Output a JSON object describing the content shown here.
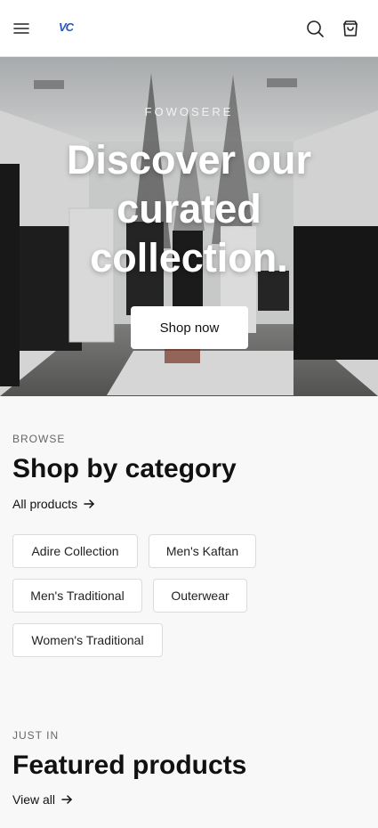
{
  "header": {
    "logo_text": "VC",
    "icons": [
      "hamburger-menu-icon",
      "search-icon",
      "shopping-bag-icon"
    ]
  },
  "hero": {
    "eyebrow": "FOWOSERE",
    "title": "Discover our curated collection.",
    "cta_label": "Shop now"
  },
  "categories": {
    "eyebrow": "BROWSE",
    "title": "Shop by category",
    "link_label": "All products",
    "items": [
      {
        "label": "Adire Collection"
      },
      {
        "label": "Men's Kaftan"
      },
      {
        "label": "Men's Traditional"
      },
      {
        "label": "Outerwear"
      },
      {
        "label": "Women's Traditional"
      }
    ]
  },
  "featured": {
    "eyebrow": "JUST IN",
    "title": "Featured products",
    "link_label": "View all"
  },
  "colors": {
    "brand": "#2a55b8",
    "background": "#f8f8f8",
    "chip_border": "#dcdcdc"
  }
}
